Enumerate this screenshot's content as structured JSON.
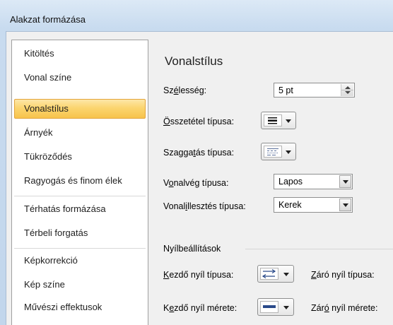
{
  "window": {
    "title": "Alakzat formázása"
  },
  "sidebar": {
    "items": [
      {
        "label": "Kitöltés"
      },
      {
        "label": "Vonal színe"
      },
      {
        "label": "Vonalstílus"
      },
      {
        "label": "Árnyék"
      },
      {
        "label": "Tükröződés"
      },
      {
        "label": "Ragyogás és finom élek"
      },
      {
        "label": "Térhatás formázása"
      },
      {
        "label": "Térbeli forgatás"
      },
      {
        "label": "Képkorrekció"
      },
      {
        "label": "Kép színe"
      },
      {
        "label": "Művészi effektusok"
      }
    ],
    "selected": "Vonalstílus"
  },
  "panel": {
    "heading": "Vonalstílus",
    "width": {
      "pre": "Sz",
      "key": "é",
      "post": "lesség:",
      "value": "5 pt"
    },
    "compound": {
      "pre": "",
      "key": "Ö",
      "post": "sszetétel típusa:",
      "icon": "compound-line-icon"
    },
    "dash": {
      "pre": "Szagga",
      "key": "t",
      "post": "ás típusa:",
      "icon": "dash-line-icon"
    },
    "cap": {
      "pre": "V",
      "key": "o",
      "post": "nalvég típusa:",
      "value": "Lapos"
    },
    "join": {
      "pre": "Vonal",
      "key": "i",
      "post": "llesztés típusa:",
      "value": "Kerek"
    },
    "arrows_group": "Nyílbeállítások",
    "begin_type": {
      "pre": "",
      "key": "K",
      "post": "ezdő nyíl típusa:",
      "icon": "arrow-type-icon"
    },
    "end_type": {
      "pre": "",
      "key": "Z",
      "post": "áró nyíl típusa:"
    },
    "begin_size": {
      "pre": "K",
      "key": "e",
      "post": "zdő nyíl mérete:",
      "icon": "arrow-size-icon"
    },
    "end_size": {
      "pre": "Zár",
      "key": "ó",
      "post": " nyíl mérete:"
    }
  }
}
